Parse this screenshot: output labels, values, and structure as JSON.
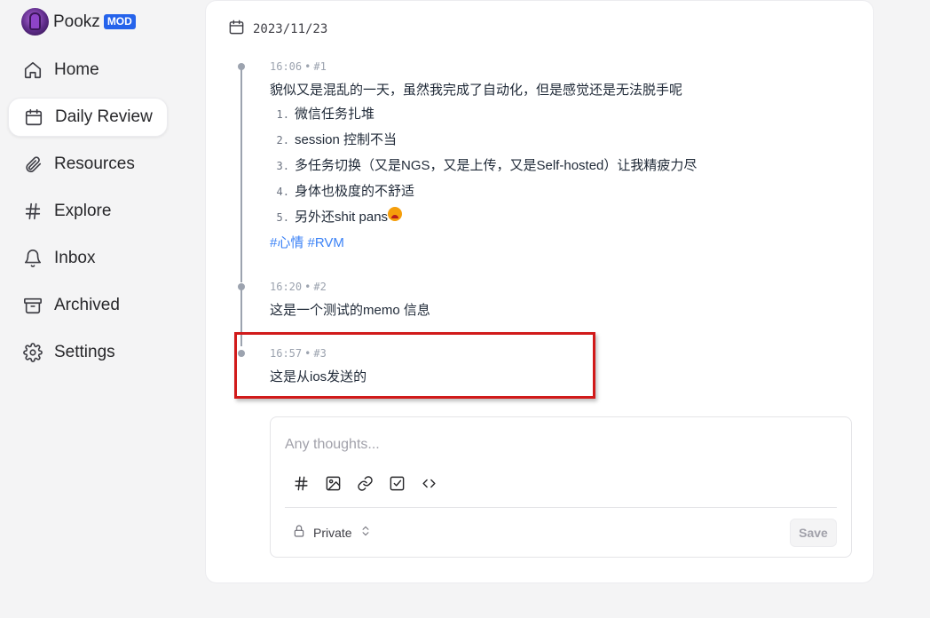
{
  "profile": {
    "username": "Pookz",
    "badge": "MOD"
  },
  "nav": {
    "items": [
      {
        "label": "Home",
        "icon": "home-icon"
      },
      {
        "label": "Daily Review",
        "icon": "calendar-icon",
        "active": true
      },
      {
        "label": "Resources",
        "icon": "paperclip-icon"
      },
      {
        "label": "Explore",
        "icon": "hash-icon"
      },
      {
        "label": "Inbox",
        "icon": "bell-icon"
      },
      {
        "label": "Archived",
        "icon": "archive-icon"
      },
      {
        "label": "Settings",
        "icon": "gear-icon"
      }
    ]
  },
  "review": {
    "date": "2023/11/23",
    "memos": [
      {
        "time": "16:06",
        "id": "#1",
        "text": "貌似又是混乱的一天，虽然我完成了自动化，但是感觉还是无法脱手呢",
        "list": [
          {
            "num": "1.",
            "text": "微信任务扎堆"
          },
          {
            "num": "2.",
            "text": "session 控制不当"
          },
          {
            "num": "3.",
            "text": "多任务切换（又是NGS，又是上传，又是Self-hosted）让我精疲力尽"
          },
          {
            "num": "4.",
            "text": "身体也极度的不舒适"
          },
          {
            "num": "5.",
            "text": "另外还shit pans"
          }
        ],
        "tags": "#心情 #RVM"
      },
      {
        "time": "16:20",
        "id": "#2",
        "text": "这是一个测试的memo 信息"
      },
      {
        "time": "16:57",
        "id": "#3",
        "text": "这是从ios发送的"
      }
    ],
    "separator": "•"
  },
  "editor": {
    "placeholder": "Any thoughts...",
    "tools": [
      "hash-icon",
      "image-icon",
      "link-icon",
      "checkbox-icon",
      "code-icon"
    ],
    "visibility": "Private",
    "save_label": "Save"
  },
  "colors": {
    "accent": "#2563eb",
    "highlight": "#d11a1a",
    "tag": "#3b82f6"
  }
}
